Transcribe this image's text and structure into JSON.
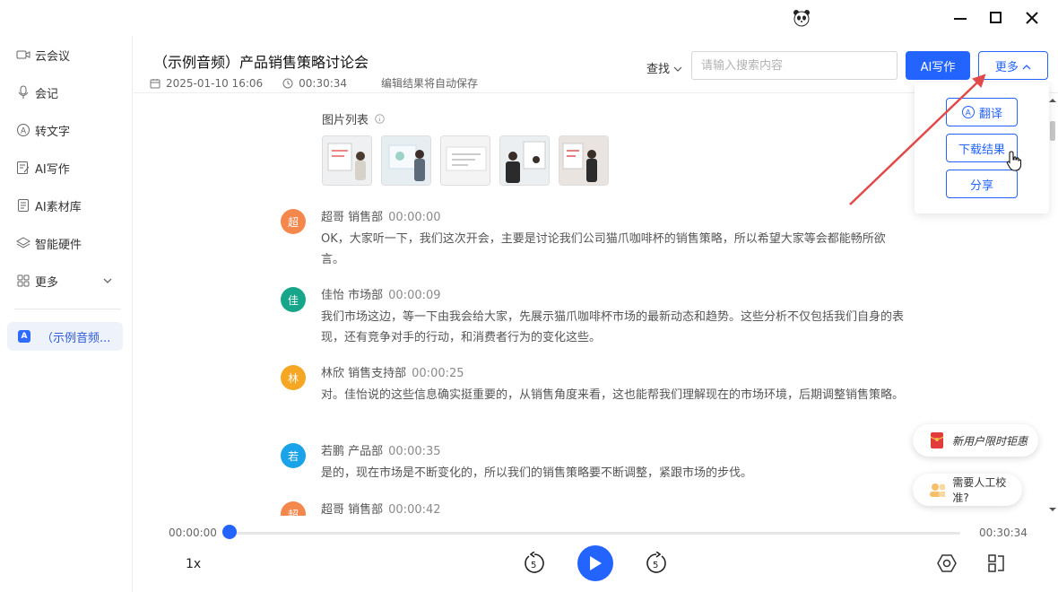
{
  "window": {
    "controls": {
      "minimize": "—",
      "maximize": "☐",
      "close": "✕"
    }
  },
  "sidebar": {
    "items": [
      {
        "label": "云会议",
        "icon": "video-icon"
      },
      {
        "label": "会记",
        "icon": "mic-icon"
      },
      {
        "label": "转文字",
        "icon": "text-convert-icon"
      },
      {
        "label": "AI写作",
        "icon": "ai-write-icon"
      },
      {
        "label": "AI素材库",
        "icon": "library-icon"
      },
      {
        "label": "智能硬件",
        "icon": "layers-icon"
      },
      {
        "label": "更多",
        "icon": "grid-icon"
      }
    ],
    "current_doc": "（示例音频..."
  },
  "header": {
    "title": "（示例音频）产品销售策略讨论会",
    "date": "2025-01-10 16:06",
    "duration": "00:30:34",
    "autosave": "编辑结果将自动保存",
    "find_label": "查找",
    "search_placeholder": "请输入搜索内容",
    "ai_button": "AI写作",
    "more_button": "更多"
  },
  "more_menu": {
    "items": [
      "翻译",
      "下载结果",
      "分享"
    ]
  },
  "content": {
    "pictures_label": "图片列表",
    "messages": [
      {
        "initial": "超",
        "color": "#f4874b",
        "speaker": "超哥 销售部",
        "time": "00:00:00",
        "text": "OK，大家听一下，我们这次开会，主要是讨论我们公司猫爪咖啡杯的销售策略，所以希望大家等会都能畅所欲言。"
      },
      {
        "initial": "佳",
        "color": "#17a689",
        "speaker": "佳怡 市场部",
        "time": "00:00:09",
        "text": "我们市场这边，等一下由我会给大家，先展示猫爪咖啡杯市场的最新动态和趋势。这些分析不仅包括我们自身的表现，还有竞争对手的行动，和消费者行为的变化这些。"
      },
      {
        "initial": "林",
        "color": "#f5a623",
        "speaker": "林欣 销售支持部",
        "time": "00:00:25",
        "text": "对。佳怡说的这些信息确实挺重要的，从销售角度来看，这也能帮我们理解现在的市场环境，后期调整销售策略。"
      },
      {
        "initial": "若",
        "color": "#1aa3e8",
        "speaker": "若鹏 产品部",
        "time": "00:00:35",
        "text": "是的，现在市场是不断变化的，所以我们的销售策略要不断调整，紧跟市场的步伐。"
      },
      {
        "initial": "超",
        "color": "#f4874b",
        "speaker": "超哥 销售部",
        "time": "00:00:42",
        "text": ""
      }
    ]
  },
  "promos": {
    "new_user": "新用户限时钜惠",
    "human_check": "需要人工校准?"
  },
  "player": {
    "current_time": "00:00:00",
    "total_time": "00:30:34",
    "speed": "1x",
    "skip_seconds": "5",
    "progress": 0
  }
}
